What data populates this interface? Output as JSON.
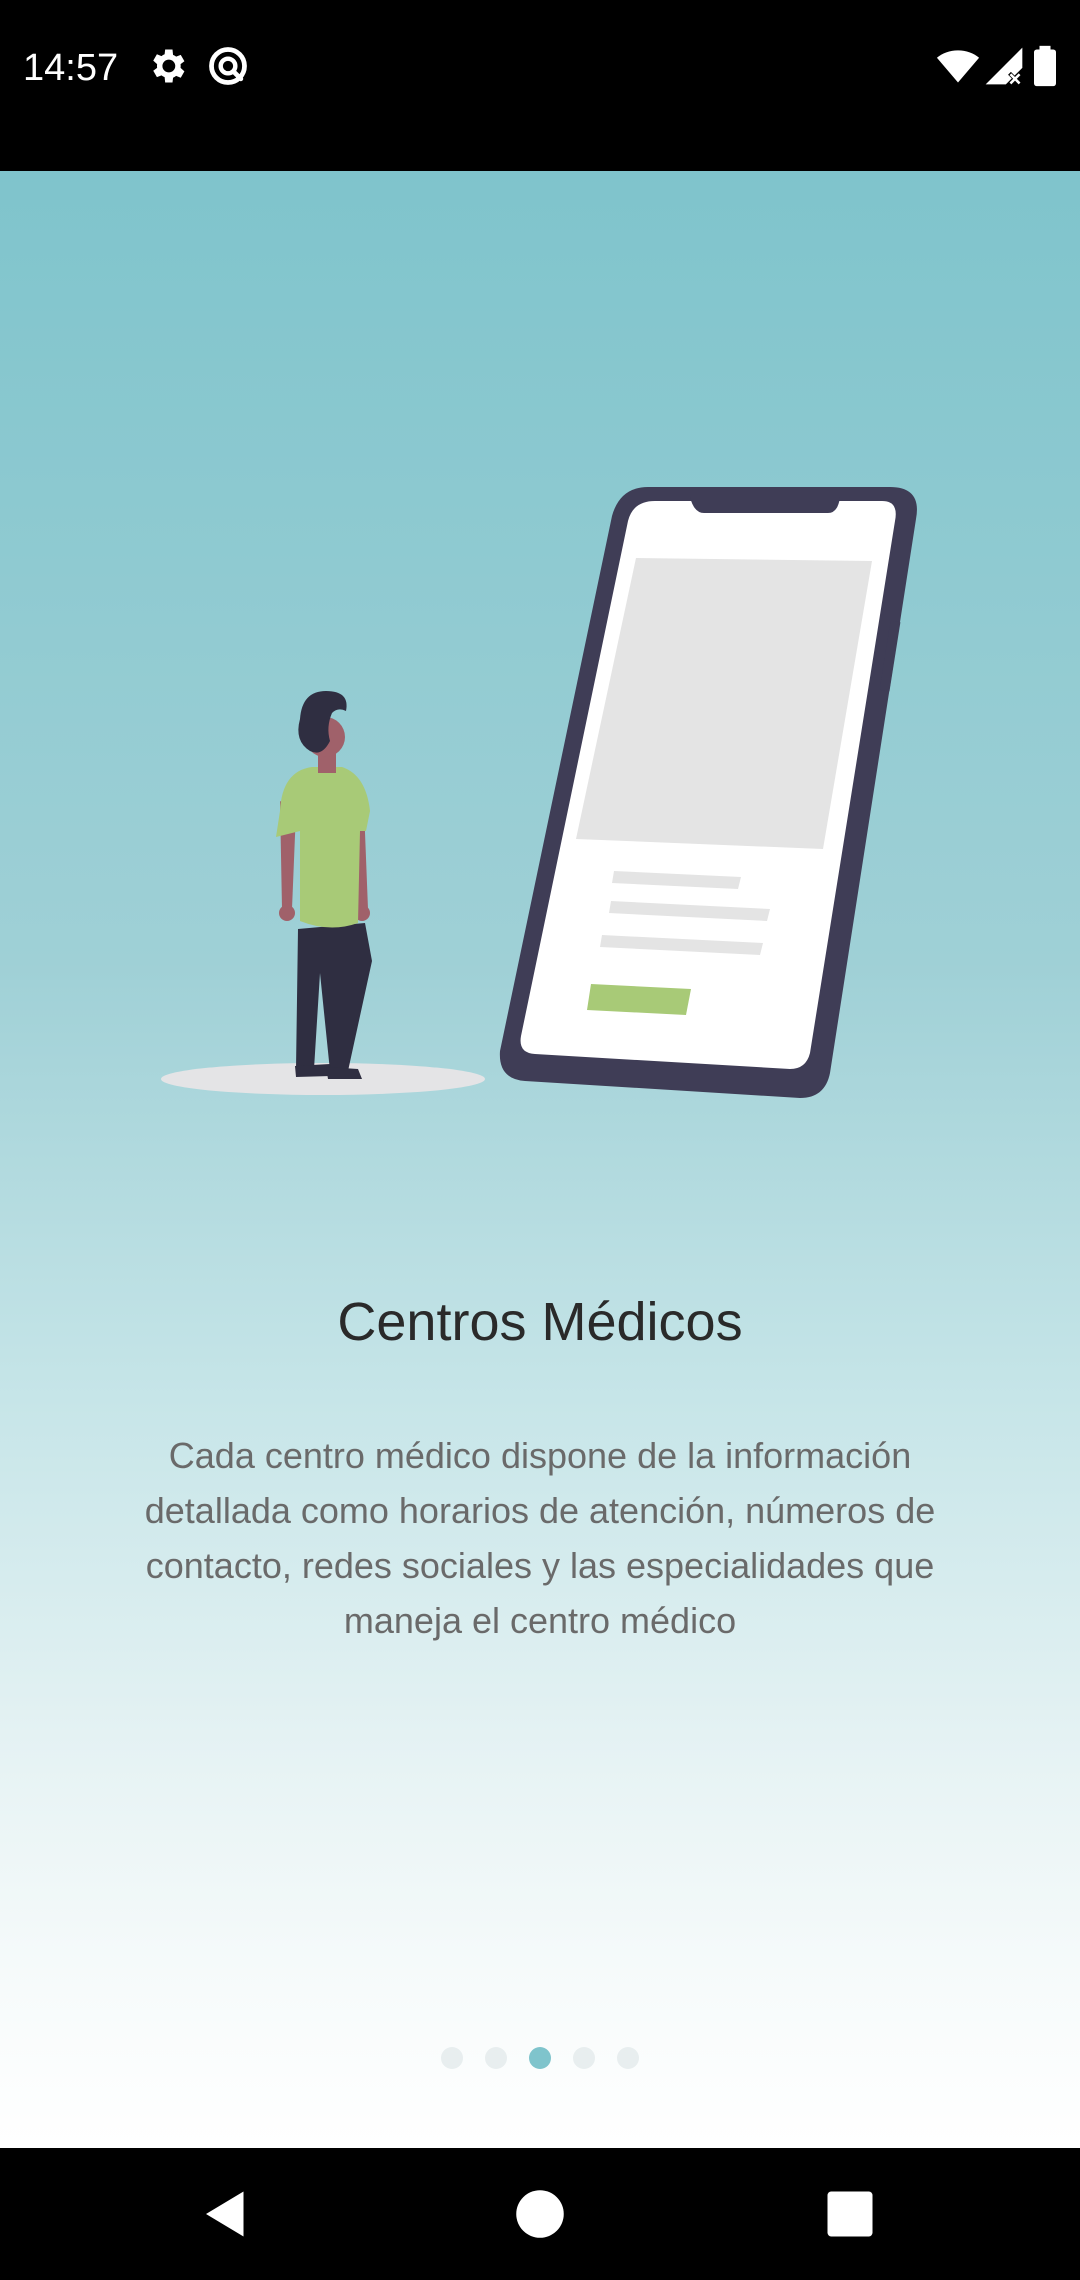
{
  "status_bar": {
    "time": "14:57",
    "icons_left": [
      "settings-gear-icon",
      "sync-circle-icon"
    ],
    "icons_right": [
      "wifi-icon",
      "cell-signal-icon",
      "battery-icon"
    ]
  },
  "onboarding": {
    "title": "Centros Médicos",
    "description": "Cada centro médico dispone de la información detallada como horarios de atención, números de contacto, redes sociales y las especialidades que maneja el centro médico",
    "page_indicator": {
      "total": 5,
      "current_index": 2
    },
    "illustration": "person-looking-at-phone",
    "accent_color": "#7fc4cc"
  },
  "nav_bar": {
    "buttons": [
      "back-icon",
      "home-icon",
      "recents-icon"
    ]
  }
}
